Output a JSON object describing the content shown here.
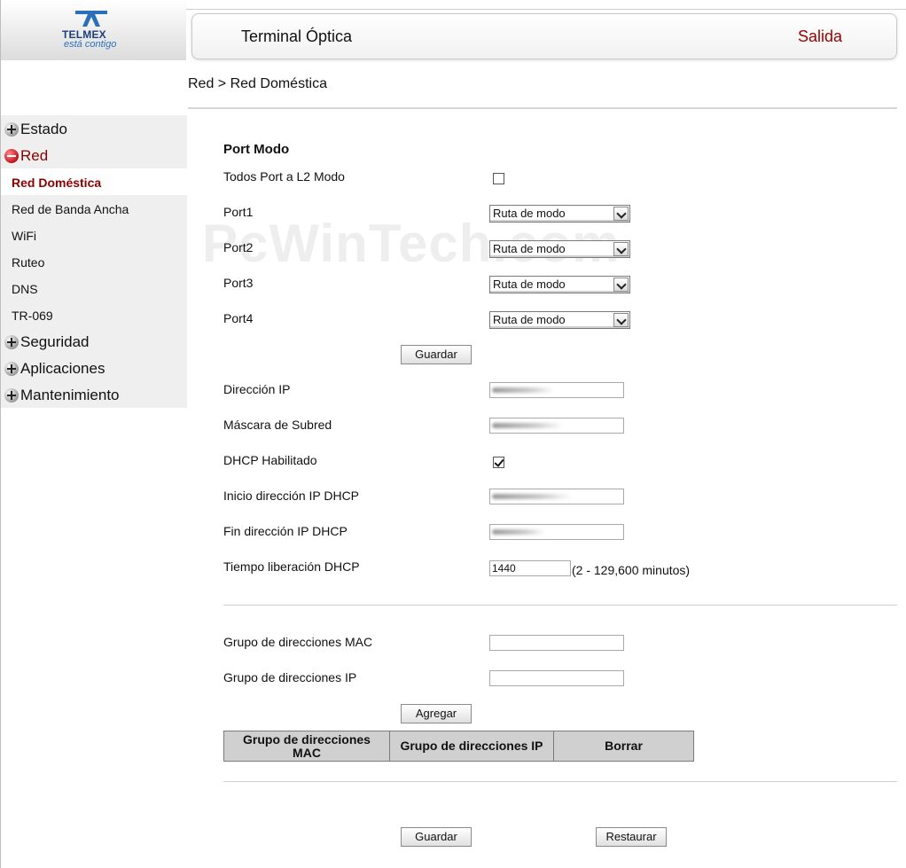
{
  "brand": {
    "name": "TELMEX",
    "tagline": "está contigo",
    "color_primary": "#1f3f7a",
    "color_accent": "#2a6fb8"
  },
  "header": {
    "title": "Terminal Óptica",
    "exit_label": "Salida",
    "exit_color": "#9b0000"
  },
  "breadcrumb": "Red > Red Doméstica",
  "watermark": "PcWinTech.com",
  "sidebar": {
    "active_color": "#8b0000",
    "sections": [
      {
        "label": "Estado",
        "icon": "plus-circle-icon",
        "expanded": false
      },
      {
        "label": "Red",
        "icon": "minus-circle-icon",
        "expanded": true
      },
      {
        "label": "Seguridad",
        "icon": "plus-circle-icon",
        "expanded": false
      },
      {
        "label": "Aplicaciones",
        "icon": "plus-circle-icon",
        "expanded": false
      },
      {
        "label": "Mantenimiento",
        "icon": "plus-circle-icon",
        "expanded": false
      }
    ],
    "red_items": [
      {
        "label": "Red Doméstica",
        "active": true
      },
      {
        "label": "Red de Banda Ancha",
        "active": false
      },
      {
        "label": "WiFi",
        "active": false
      },
      {
        "label": "Ruteo",
        "active": false
      },
      {
        "label": "DNS",
        "active": false
      },
      {
        "label": "TR-069",
        "active": false
      }
    ]
  },
  "port_mode": {
    "title": "Port Modo",
    "all_l2_label": "Todos Port a L2 Modo",
    "all_l2_checked": false,
    "ports": [
      {
        "label": "Port1",
        "value": "Ruta de modo"
      },
      {
        "label": "Port2",
        "value": "Ruta de modo"
      },
      {
        "label": "Port3",
        "value": "Ruta de modo"
      },
      {
        "label": "Port4",
        "value": "Ruta de modo"
      }
    ],
    "save_label": "Guardar"
  },
  "lan": {
    "ip_label": "Dirección IP",
    "mask_label": "Máscara de Subred",
    "dhcp_enabled_label": "DHCP Habilitado",
    "dhcp_enabled": true,
    "dhcp_start_label": "Inicio dirección IP DHCP",
    "dhcp_end_label": "Fin dirección IP DHCP",
    "lease_label": "Tiempo liberación DHCP",
    "lease_value": "1440",
    "lease_hint": "(2 - 129,600 minutos)"
  },
  "binding": {
    "mac_label": "Grupo de direcciones MAC",
    "mac_value": "",
    "ip_label": "Grupo de direcciones IP",
    "ip_value": "",
    "add_label": "Agregar",
    "table_headers": [
      "Grupo de direcciones MAC",
      "Grupo de direcciones IP",
      "Borrar"
    ]
  },
  "footer": {
    "save_label": "Guardar",
    "restore_label": "Restaurar"
  }
}
